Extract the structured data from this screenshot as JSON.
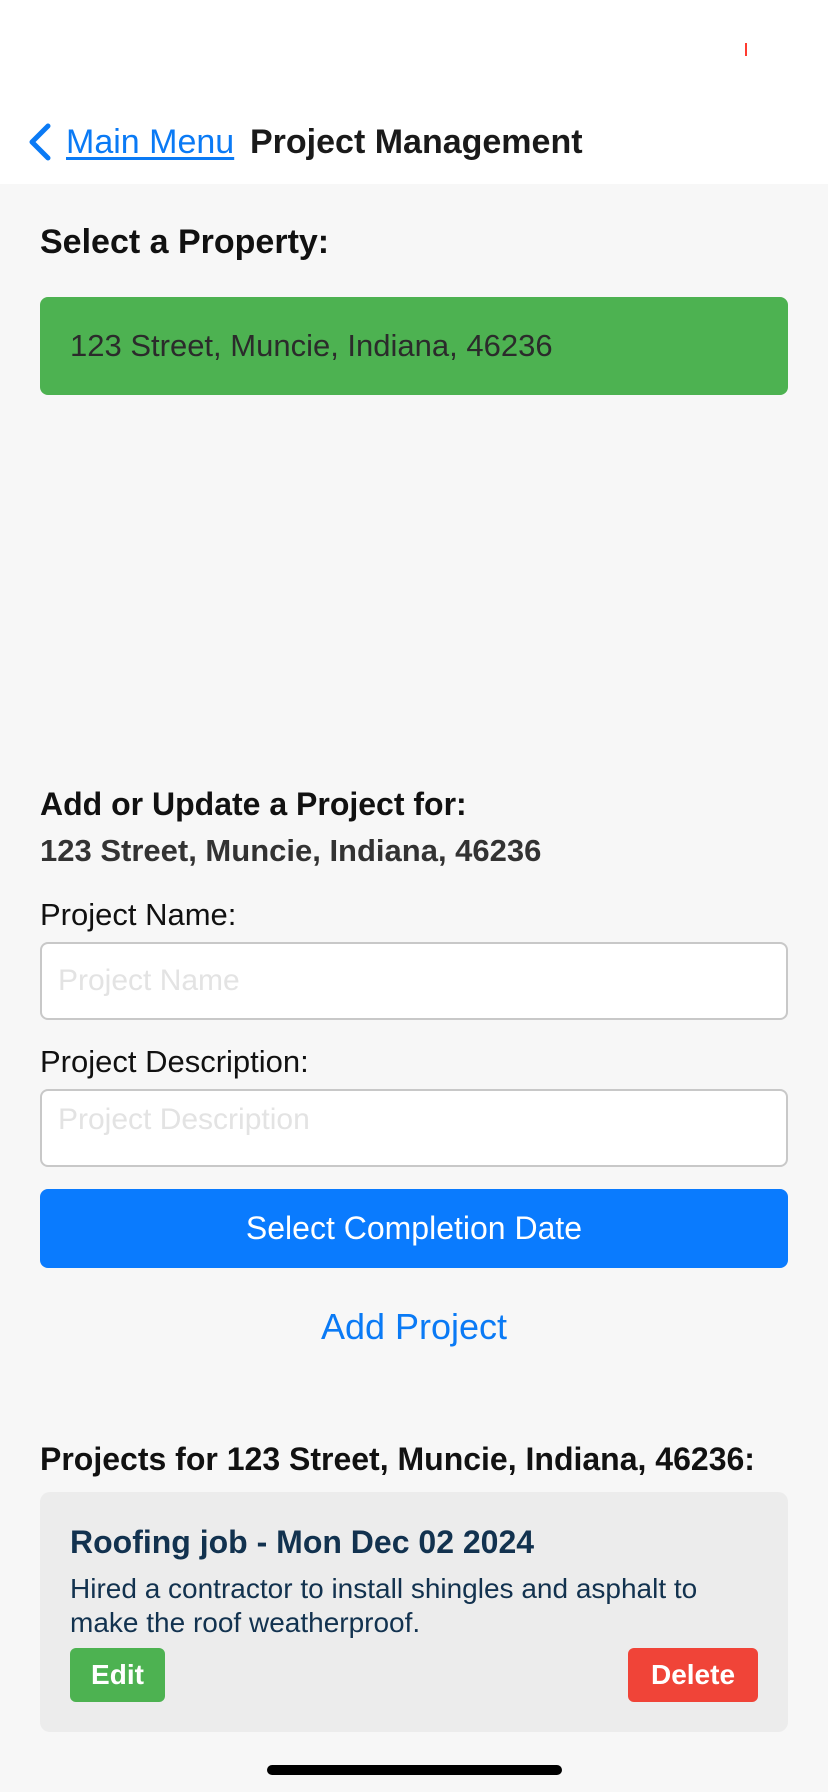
{
  "nav": {
    "back_label": "Main Menu",
    "title": "Project Management"
  },
  "property_section": {
    "heading": "Select a Property:",
    "selected_property": "123 Street, Muncie, Indiana, 46236"
  },
  "form": {
    "heading": "Add or Update a Project for:",
    "property_address": "123 Street, Muncie, Indiana, 46236",
    "name_label": "Project Name:",
    "name_placeholder": "Project Name",
    "name_value": "",
    "description_label": "Project Description:",
    "description_placeholder": "Project Description",
    "description_value": "",
    "date_button_label": "Select Completion Date",
    "add_button_label": "Add Project"
  },
  "projects_section": {
    "heading": "Projects for 123 Street, Muncie, Indiana, 46236:",
    "items": [
      {
        "title": "Roofing job - Mon Dec 02 2024",
        "description": "Hired a contractor to install shingles and asphalt to make the roof weatherproof.",
        "edit_label": "Edit",
        "delete_label": "Delete"
      }
    ]
  },
  "colors": {
    "accent_blue": "#0a7bfe",
    "link_blue": "#0a7af5",
    "selected_green": "#4db251",
    "delete_red": "#f04438",
    "card_text": "#12324f",
    "background": "#f7f7f7"
  },
  "icons": {
    "back": "chevron-left-icon"
  }
}
